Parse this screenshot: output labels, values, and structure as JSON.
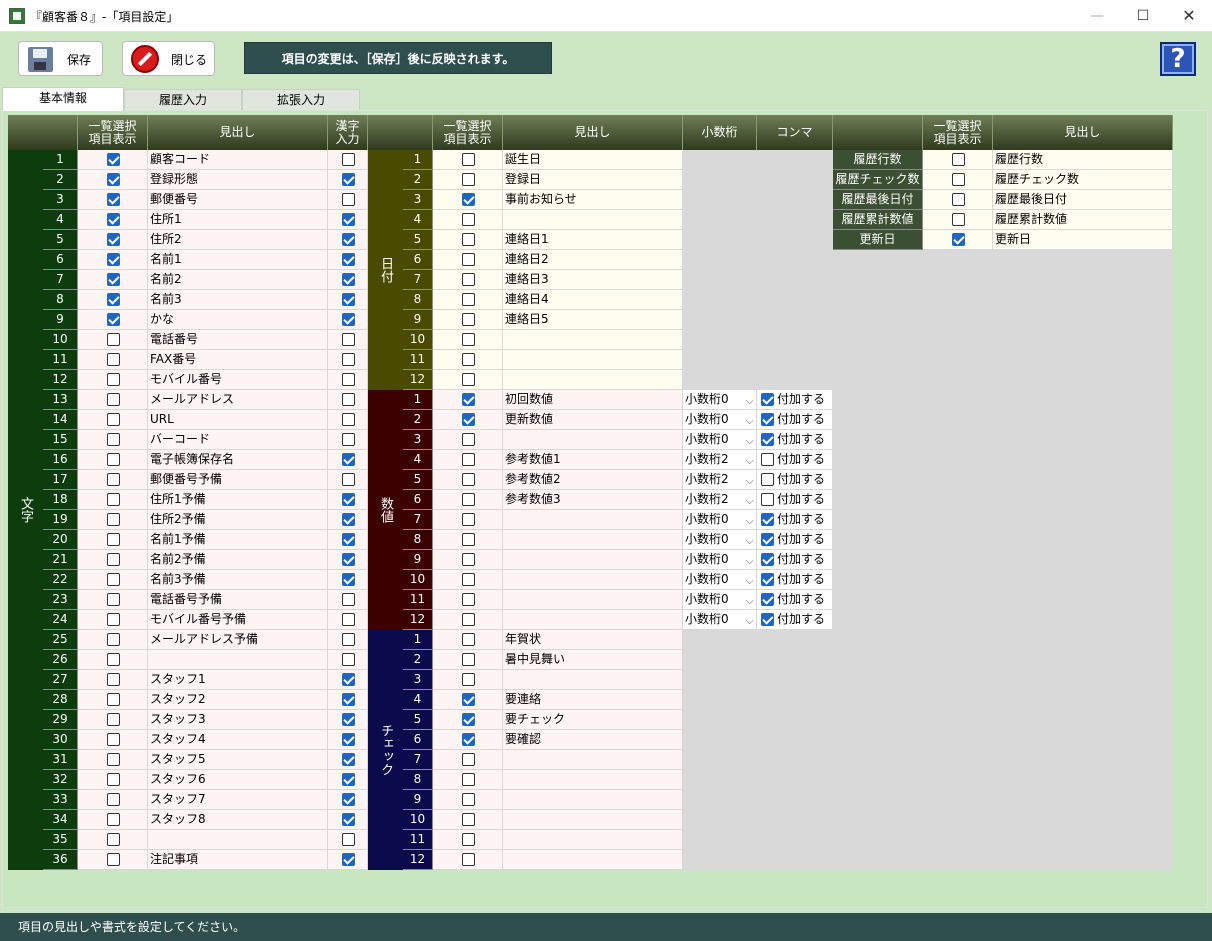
{
  "window": {
    "title": "『顧客番８』-「項目設定」",
    "minimize": "—",
    "maximize": "☐",
    "close": "✕"
  },
  "toolbar": {
    "save_label": "保存",
    "close_label": "閉じる",
    "notice": "項目の変更は、［保存］後に反映されます。",
    "help": "?"
  },
  "tabs": [
    "基本情報",
    "履歴入力",
    "拡張入力"
  ],
  "headers": {
    "list_display": "一覧選択\n項目表示",
    "heading": "見出し",
    "kanji": "漢字\n入力",
    "decimal": "小数桁",
    "comma": "コンマ"
  },
  "groups": {
    "text": "文字",
    "date": "日付",
    "number": "数値",
    "check": "チェック"
  },
  "text_rows": [
    {
      "no": "1",
      "list": true,
      "label": "顧客コード",
      "kanji": false
    },
    {
      "no": "2",
      "list": true,
      "label": "登録形態",
      "kanji": true
    },
    {
      "no": "3",
      "list": true,
      "label": "郵便番号",
      "kanji": false
    },
    {
      "no": "4",
      "list": true,
      "label": "住所1",
      "kanji": true
    },
    {
      "no": "5",
      "list": true,
      "label": "住所2",
      "kanji": true
    },
    {
      "no": "6",
      "list": true,
      "label": "名前1",
      "kanji": true
    },
    {
      "no": "7",
      "list": true,
      "label": "名前2",
      "kanji": true
    },
    {
      "no": "8",
      "list": true,
      "label": "名前3",
      "kanji": true
    },
    {
      "no": "9",
      "list": true,
      "label": "かな",
      "kanji": true
    },
    {
      "no": "10",
      "list": false,
      "label": "電話番号",
      "kanji": false
    },
    {
      "no": "11",
      "list": false,
      "label": "FAX番号",
      "kanji": false
    },
    {
      "no": "12",
      "list": false,
      "label": "モバイル番号",
      "kanji": false
    },
    {
      "no": "13",
      "list": false,
      "label": "メールアドレス",
      "kanji": false
    },
    {
      "no": "14",
      "list": false,
      "label": "URL",
      "kanji": false
    },
    {
      "no": "15",
      "list": false,
      "label": "バーコード",
      "kanji": false
    },
    {
      "no": "16",
      "list": false,
      "label": "電子帳簿保存名",
      "kanji": true
    },
    {
      "no": "17",
      "list": false,
      "label": "郵便番号予備",
      "kanji": false
    },
    {
      "no": "18",
      "list": false,
      "label": "住所1予備",
      "kanji": true
    },
    {
      "no": "19",
      "list": false,
      "label": "住所2予備",
      "kanji": true
    },
    {
      "no": "20",
      "list": false,
      "label": "名前1予備",
      "kanji": true
    },
    {
      "no": "21",
      "list": false,
      "label": "名前2予備",
      "kanji": true
    },
    {
      "no": "22",
      "list": false,
      "label": "名前3予備",
      "kanji": true
    },
    {
      "no": "23",
      "list": false,
      "label": "電話番号予備",
      "kanji": false
    },
    {
      "no": "24",
      "list": false,
      "label": "モバイル番号予備",
      "kanji": false
    },
    {
      "no": "25",
      "list": false,
      "label": "メールアドレス予備",
      "kanji": false
    },
    {
      "no": "26",
      "list": false,
      "label": "",
      "kanji": false
    },
    {
      "no": "27",
      "list": false,
      "label": "スタッフ1",
      "kanji": true
    },
    {
      "no": "28",
      "list": false,
      "label": "スタッフ2",
      "kanji": true
    },
    {
      "no": "29",
      "list": false,
      "label": "スタッフ3",
      "kanji": true
    },
    {
      "no": "30",
      "list": false,
      "label": "スタッフ4",
      "kanji": true
    },
    {
      "no": "31",
      "list": false,
      "label": "スタッフ5",
      "kanji": true
    },
    {
      "no": "32",
      "list": false,
      "label": "スタッフ6",
      "kanji": true
    },
    {
      "no": "33",
      "list": false,
      "label": "スタッフ7",
      "kanji": true
    },
    {
      "no": "34",
      "list": false,
      "label": "スタッフ8",
      "kanji": true
    },
    {
      "no": "35",
      "list": false,
      "label": "",
      "kanji": false
    },
    {
      "no": "36",
      "list": false,
      "label": "注記事項",
      "kanji": true
    }
  ],
  "date_rows": [
    {
      "no": "1",
      "list": false,
      "label": "誕生日"
    },
    {
      "no": "2",
      "list": false,
      "label": "登録日"
    },
    {
      "no": "3",
      "list": true,
      "label": "事前お知らせ"
    },
    {
      "no": "4",
      "list": false,
      "label": ""
    },
    {
      "no": "5",
      "list": false,
      "label": "連絡日1"
    },
    {
      "no": "6",
      "list": false,
      "label": "連絡日2"
    },
    {
      "no": "7",
      "list": false,
      "label": "連絡日3"
    },
    {
      "no": "8",
      "list": false,
      "label": "連絡日4"
    },
    {
      "no": "9",
      "list": false,
      "label": "連絡日5"
    },
    {
      "no": "10",
      "list": false,
      "label": ""
    },
    {
      "no": "11",
      "list": false,
      "label": ""
    },
    {
      "no": "12",
      "list": false,
      "label": ""
    }
  ],
  "number_rows": [
    {
      "no": "1",
      "list": true,
      "label": "初回数値",
      "decimal": "小数桁0",
      "comma": true
    },
    {
      "no": "2",
      "list": true,
      "label": "更新数値",
      "decimal": "小数桁0",
      "comma": true
    },
    {
      "no": "3",
      "list": false,
      "label": "",
      "decimal": "小数桁0",
      "comma": true
    },
    {
      "no": "4",
      "list": false,
      "label": "参考数値1",
      "decimal": "小数桁2",
      "comma": false
    },
    {
      "no": "5",
      "list": false,
      "label": "参考数値2",
      "decimal": "小数桁2",
      "comma": false
    },
    {
      "no": "6",
      "list": false,
      "label": "参考数値3",
      "decimal": "小数桁2",
      "comma": false
    },
    {
      "no": "7",
      "list": false,
      "label": "",
      "decimal": "小数桁0",
      "comma": true
    },
    {
      "no": "8",
      "list": false,
      "label": "",
      "decimal": "小数桁0",
      "comma": true
    },
    {
      "no": "9",
      "list": false,
      "label": "",
      "decimal": "小数桁0",
      "comma": true
    },
    {
      "no": "10",
      "list": false,
      "label": "",
      "decimal": "小数桁0",
      "comma": true
    },
    {
      "no": "11",
      "list": false,
      "label": "",
      "decimal": "小数桁0",
      "comma": true
    },
    {
      "no": "12",
      "list": false,
      "label": "",
      "decimal": "小数桁0",
      "comma": true
    }
  ],
  "comma_label": "付加する",
  "check_rows": [
    {
      "no": "1",
      "list": false,
      "label": "年賀状"
    },
    {
      "no": "2",
      "list": false,
      "label": "暑中見舞い"
    },
    {
      "no": "3",
      "list": false,
      "label": ""
    },
    {
      "no": "4",
      "list": true,
      "label": "要連絡"
    },
    {
      "no": "5",
      "list": true,
      "label": "要チェック"
    },
    {
      "no": "6",
      "list": true,
      "label": "要確認"
    },
    {
      "no": "7",
      "list": false,
      "label": ""
    },
    {
      "no": "8",
      "list": false,
      "label": ""
    },
    {
      "no": "9",
      "list": false,
      "label": ""
    },
    {
      "no": "10",
      "list": false,
      "label": ""
    },
    {
      "no": "11",
      "list": false,
      "label": ""
    },
    {
      "no": "12",
      "list": false,
      "label": ""
    }
  ],
  "history_rows": [
    {
      "name": "履歴行数",
      "list": false,
      "label": "履歴行数"
    },
    {
      "name": "履歴チェック数",
      "list": false,
      "label": "履歴チェック数"
    },
    {
      "name": "履歴最後日付",
      "list": false,
      "label": "履歴最後日付"
    },
    {
      "name": "履歴累計数値",
      "list": false,
      "label": "履歴累計数値"
    },
    {
      "name": "更新日",
      "list": true,
      "label": "更新日"
    }
  ],
  "status": "項目の見出しや書式を設定してください。",
  "colors": {
    "text_group": "#0d3d0d",
    "date_group": "#4a4a00",
    "number_group": "#3d0000",
    "check_group": "#0a0a4d",
    "history_name": "#3b4f32",
    "checkbox_on": "#1f65c2"
  }
}
